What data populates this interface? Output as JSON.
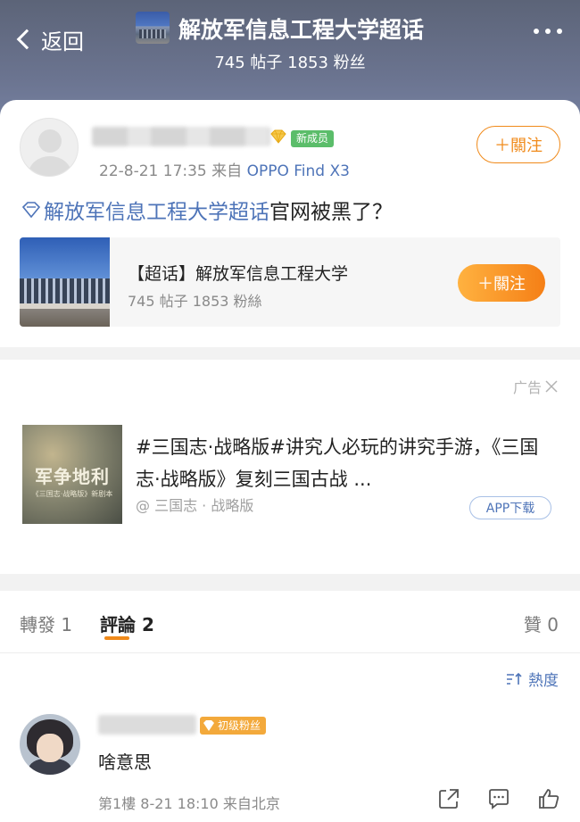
{
  "header": {
    "back_label": "返回",
    "title": "解放军信息工程大学超话",
    "stats": "745 帖子 1853 粉丝",
    "more_icon": "more-dots-icon"
  },
  "post": {
    "badge": "新成员",
    "meta_prefix": "22-8-21 17:35  来自 ",
    "meta_source": "OPPO Find X3",
    "follow_label": "＋關注",
    "topic_link": "解放军信息工程大学超话",
    "text_tail": "官网被黑了？",
    "topic_card": {
      "title": "【超话】解放军信息工程大学",
      "stats": "745 帖子 1853 粉絲",
      "follow_label": "＋關注"
    }
  },
  "ad": {
    "label": "广告",
    "thumb_caption": "军争地利",
    "thumb_sub": "《三国志·战略版》新剧本",
    "text": "#三国志·战略版#讲究人必玩的讲究手游，《三国志·战略版》复刻三国古战 ...",
    "source": "@ 三国志 · 战略版",
    "app_button": "APP下载"
  },
  "tabs": {
    "repost": "轉發 1",
    "comment": "評論 2",
    "like": "贊 0"
  },
  "comments": {
    "sort_label": "熱度",
    "items": [
      {
        "badge": "初级粉丝",
        "text": "啥意思",
        "meta": "第1樓  8-21 18:10  来自北京"
      }
    ]
  },
  "colors": {
    "accent": "#f08a1a",
    "link": "#4e74b8",
    "header_bg": "#6b7490",
    "new_badge": "#5bbd6a"
  }
}
